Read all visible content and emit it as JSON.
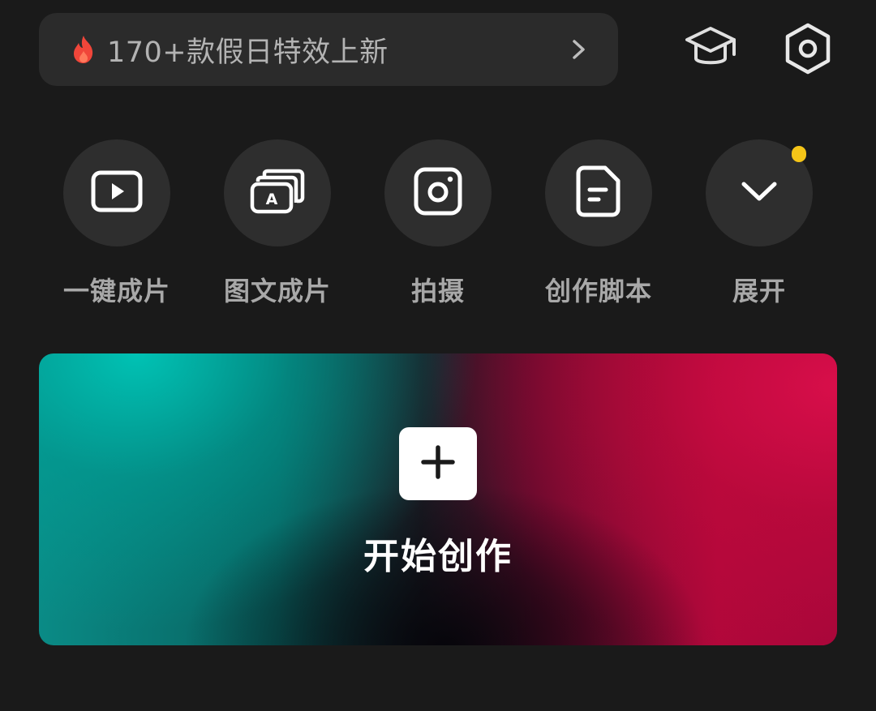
{
  "promo": {
    "icon": "fire-icon",
    "text": "170+款假日特效上新",
    "arrow_icon": "chevron-right-icon",
    "fire_color": "#f0463a"
  },
  "top_icons": {
    "tutorial": "graduation-cap-icon",
    "settings": "hexagon-settings-icon"
  },
  "actions": [
    {
      "label": "一键成片",
      "icon": "play-icon"
    },
    {
      "label": "图文成片",
      "icon": "text-card-icon"
    },
    {
      "label": "拍摄",
      "icon": "camera-icon"
    },
    {
      "label": "创作脚本",
      "icon": "script-icon"
    },
    {
      "label": "展开",
      "icon": "chevron-down-icon",
      "has_badge": true,
      "badge_color": "#f5c518"
    }
  ],
  "create": {
    "label": "开始创作",
    "icon": "plus-icon"
  }
}
